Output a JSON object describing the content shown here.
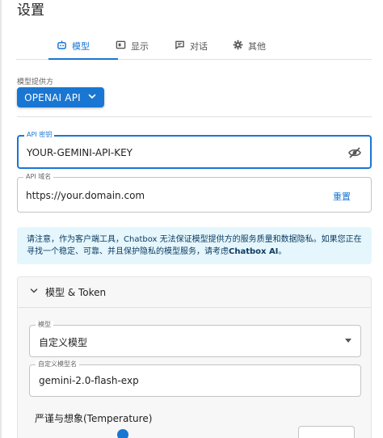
{
  "page": {
    "title": "设置"
  },
  "tabs": [
    {
      "label": "模型",
      "icon": "robot-icon",
      "active": true
    },
    {
      "label": "显示",
      "icon": "display-icon",
      "active": false
    },
    {
      "label": "对话",
      "icon": "chat-icon",
      "active": false
    },
    {
      "label": "其他",
      "icon": "gear-icon",
      "active": false
    }
  ],
  "provider": {
    "section_label": "模型提供方",
    "selected": "OPENAI API"
  },
  "api_key": {
    "legend": "API 密钥",
    "value": "YOUR-GEMINI-API-KEY"
  },
  "api_host": {
    "legend": "API 域名",
    "value": "https://your.domain.com",
    "reset_label": "重置"
  },
  "notice": {
    "text": "请注意，作为客户端工具，Chatbox 无法保证模型提供方的服务质量和数据隐私。如果您正在寻找一个稳定、可靠、并且保护隐私的模型服务，请考虑",
    "link_text": "Chatbox AI",
    "suffix": "。"
  },
  "model_section": {
    "header": "模型 & Token",
    "model_legend": "模型",
    "model_value": "自定义模型",
    "custom_legend": "自定义模型名",
    "custom_value": "gemini-2.0-flash-exp",
    "temperature_label": "严谨与想象(Temperature)"
  },
  "colors": {
    "accent": "#1976d2",
    "notice_bg": "#e5f6fd",
    "notice_text": "#0d3c61"
  }
}
